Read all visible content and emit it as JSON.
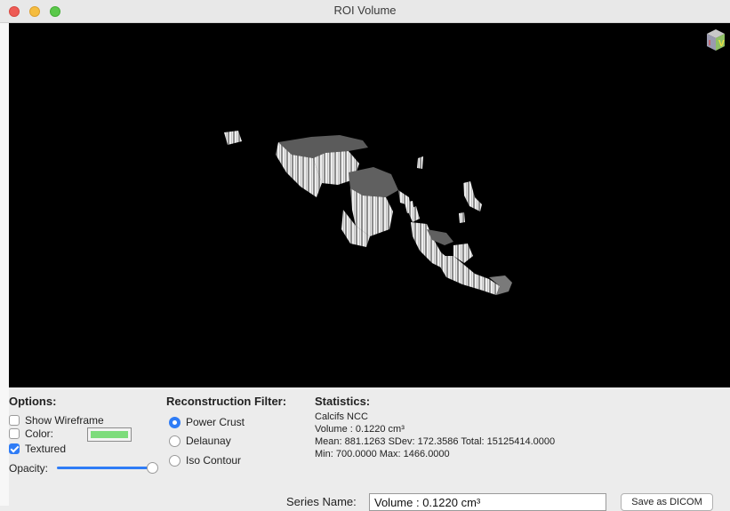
{
  "window": {
    "title": "ROI Volume"
  },
  "options": {
    "heading": "Options:",
    "show_wireframe": {
      "label": "Show Wireframe",
      "checked": false
    },
    "color": {
      "label": "Color:",
      "checked": false,
      "swatch": "#7ddc7b"
    },
    "textured": {
      "label": "Textured",
      "checked": true
    },
    "opacity": {
      "label": "Opacity:",
      "value": 1.0
    }
  },
  "filter": {
    "heading": "Reconstruction Filter:",
    "options": [
      {
        "label": "Power Crust",
        "selected": true
      },
      {
        "label": "Delaunay",
        "selected": false
      },
      {
        "label": "Iso Contour",
        "selected": false
      }
    ]
  },
  "statistics": {
    "heading": "Statistics:",
    "name": "Calcifs NCC",
    "volume": "Volume : 0.1220 cm³",
    "mean_line": "Mean: 881.1263 SDev: 172.3586 Total: 15125414.0000",
    "minmax_line": "Min: 700.0000 Max: 1466.0000"
  },
  "series": {
    "label": "Series Name:",
    "value": "Volume : 0.1220 cm³"
  },
  "buttons": {
    "save_dicom": "Save  as DICOM"
  },
  "colors": {
    "accent": "#2f7cf6",
    "viewport_bg": "#000000"
  },
  "icons": {
    "orientation_cube": "orientation-cube-icon"
  }
}
